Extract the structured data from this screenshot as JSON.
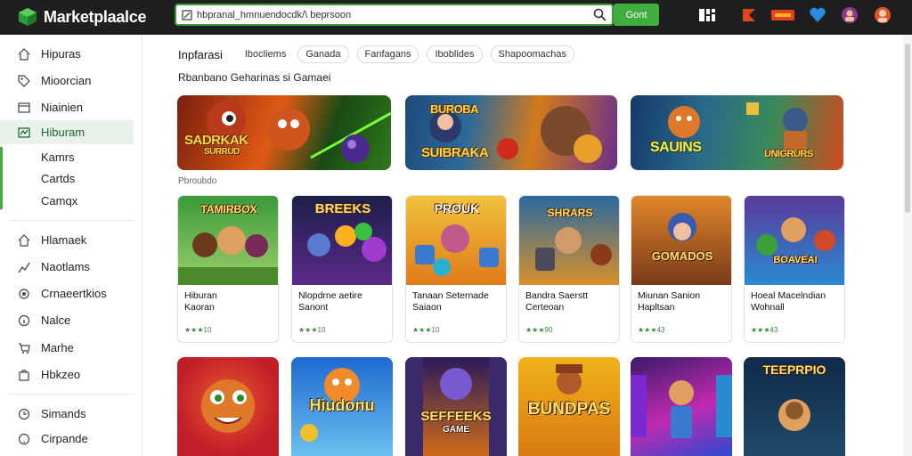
{
  "topbar": {
    "brand": "Marketplaalce",
    "search_value": "hbpranal_hmnuendocdk/\\ beprsoon",
    "search_placeholder": "Search",
    "go_label": "Gont",
    "icons": [
      "app-grid-icon",
      "flag-icon",
      "deals-icon",
      "heart-icon",
      "profile-badge-icon",
      "avatar-icon"
    ]
  },
  "sidebar": {
    "items": [
      {
        "label": "Hipuras",
        "icon": "home-icon"
      },
      {
        "label": "Mioorcian",
        "icon": "tag-icon"
      },
      {
        "label": "Niainien",
        "icon": "window-icon"
      },
      {
        "label": "Hiburam",
        "icon": "games-icon",
        "active": true
      },
      {
        "label": "Kamrs",
        "icon": "none"
      },
      {
        "label": "Cartds",
        "icon": "none"
      },
      {
        "label": "Camqx",
        "icon": "none"
      },
      {
        "label": "Hlamaek",
        "icon": "home-icon"
      },
      {
        "label": "Naotlams",
        "icon": "chart-icon"
      },
      {
        "label": "Crnaeertkios",
        "icon": "settings-icon"
      },
      {
        "label": "Nalce",
        "icon": "info-icon"
      },
      {
        "label": "Marhe",
        "icon": "cart-icon"
      },
      {
        "label": "Hbkzeo",
        "icon": "bag-icon"
      },
      {
        "label": "Simands",
        "icon": "clock-icon"
      },
      {
        "label": "Cirpande",
        "icon": "help-icon"
      }
    ]
  },
  "tabs": {
    "title": "Inpfarasi",
    "items": [
      "Ibocliems",
      "Ganada",
      "Fanfagans",
      "Iboblides",
      "Shapoomachas"
    ]
  },
  "sections": {
    "featured_title": "Rbanbano Geharinas si Gamaei",
    "popular_title": "Pbroubdo"
  },
  "banners": [
    {
      "text": "SADRKAK",
      "sub": "SURRUD",
      "colors": [
        "#7a1f10",
        "#e05a14",
        "#2f7a1c"
      ]
    },
    {
      "text": "BUROBA",
      "sub": "SUIBRAKA",
      "colors": [
        "#1f4a7a",
        "#d27a1c",
        "#6a2f8a"
      ]
    },
    {
      "text": "SAUINS",
      "sub": "UNIGRURS",
      "colors": [
        "#153a6a",
        "#3a8a5a",
        "#d24a1c"
      ]
    }
  ],
  "games": [
    {
      "title": "TAMIRBOX",
      "name": "Hiburan",
      "name2": "Kaoran",
      "rating": "★★★10",
      "colors": [
        "#3a9a3a",
        "#9fd06a"
      ]
    },
    {
      "title": "BREEKS",
      "name": "Nlopdrne aetire",
      "name2": "Sanont",
      "rating": "★★★10",
      "colors": [
        "#1d1e4a",
        "#5a2a8a"
      ]
    },
    {
      "title": "PROUK",
      "name": "Tanaan Seternade",
      "name2": "Saiaon",
      "rating": "★★★10",
      "colors": [
        "#f0c23a",
        "#e07a1a"
      ]
    },
    {
      "title": "SHRARS",
      "name": "Bandra Saerstt",
      "name2": "Certeoan",
      "rating": "★★★90",
      "colors": [
        "#2a6aa0",
        "#d8902a"
      ]
    },
    {
      "title": "GOMADOS",
      "name": "Miunan Sanion",
      "name2": "Hapltsan",
      "rating": "★★★43",
      "colors": [
        "#e0862a",
        "#7a3a1a"
      ]
    },
    {
      "title": "BOAVEAI",
      "name": "Hoeal Macelndian",
      "name2": "Wohnall",
      "rating": "★★★43",
      "colors": [
        "#5a3a9a",
        "#2a8ad0"
      ]
    }
  ],
  "games_row2": [
    {
      "title": "",
      "colors": [
        "#c21e2a",
        "#e85a2a"
      ]
    },
    {
      "title": "Hiudonu",
      "colors": [
        "#1e6ad0",
        "#6ac0f0"
      ]
    },
    {
      "title": "SEFFEEKS",
      "sub": "GAME",
      "colors": [
        "#2a1a5a",
        "#d06a1a"
      ]
    },
    {
      "title": "BUNDPAS",
      "colors": [
        "#f0b21a",
        "#d87a10"
      ]
    },
    {
      "title": "",
      "colors": [
        "#3a1a6a",
        "#c02ab0"
      ]
    },
    {
      "title": "TEEPRPIO",
      "colors": [
        "#0f2a4a",
        "#e0a020"
      ]
    }
  ],
  "palette": {
    "accent": "#3fae3f",
    "topbar": "#1f1f1f",
    "active_bg": "#e9f2ea"
  }
}
